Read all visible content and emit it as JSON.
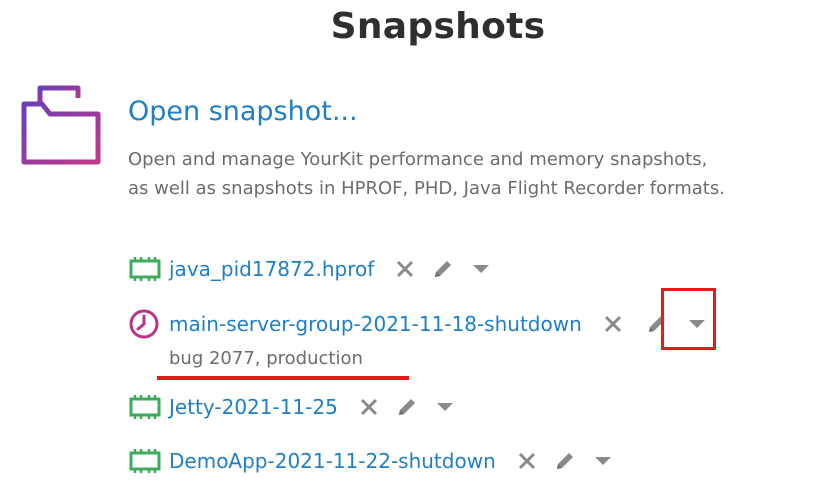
{
  "header": {
    "title": "Snapshots"
  },
  "open_snapshot": {
    "label": "Open snapshot...",
    "description_line1": "Open and manage YourKit performance and memory snapshots,",
    "description_line2": "as well as snapshots in HPROF, PHD, Java Flight Recorder formats."
  },
  "snapshots": [
    {
      "name": "java_pid17872.hprof",
      "icon": "memory-snapshot-icon"
    },
    {
      "name": "main-server-group-2021-11-18-shutdown",
      "icon": "performance-snapshot-icon",
      "tags": "bug 2077, production"
    },
    {
      "name": "Jetty-2021-11-25",
      "icon": "memory-snapshot-icon"
    },
    {
      "name": "DemoApp-2021-11-22-shutdown",
      "icon": "memory-snapshot-icon"
    }
  ],
  "colors": {
    "link": "#1e7fc7",
    "memory_icon": "#3daa5c",
    "perf_icon": "#b8358a",
    "action_icon": "#8a8a8a",
    "annotation": "#e51b1b"
  }
}
